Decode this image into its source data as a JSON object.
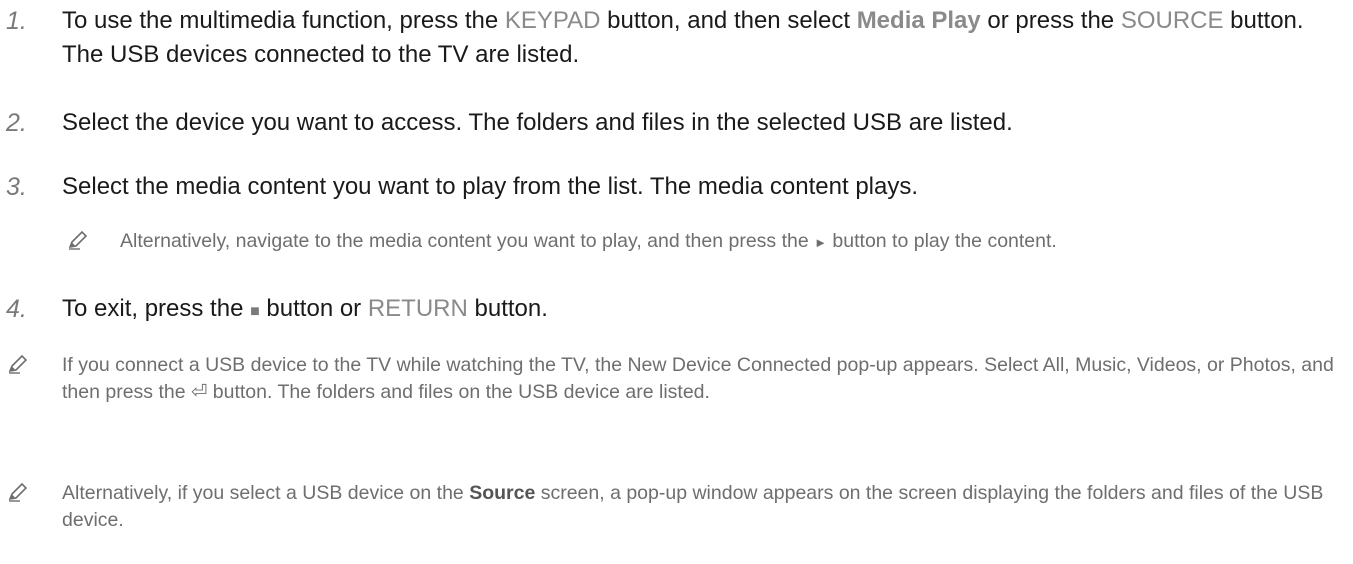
{
  "steps": [
    {
      "num": "1.",
      "parts": [
        {
          "t": "To use the multimedia function, press the "
        },
        {
          "t": "KEYPAD",
          "kw": true
        },
        {
          "t": " button, and then select "
        },
        {
          "t": "Media Play",
          "kwb": true
        },
        {
          "t": " or press the "
        },
        {
          "t": "SOURCE",
          "kw": true
        },
        {
          "t": " button. The USB devices connected to the TV are listed."
        }
      ]
    },
    {
      "num": "2.",
      "parts": [
        {
          "t": "Select the device you want to access. The folders and files in the selected USB are listed."
        }
      ]
    },
    {
      "num": "3.",
      "parts": [
        {
          "t": "Select the media content you want to play from the list. The media content plays."
        }
      ]
    },
    {
      "num": "4.",
      "parts": [
        {
          "t": "To exit, press the "
        },
        {
          "t": "■",
          "glyph": "stop-icon"
        },
        {
          "t": " button or "
        },
        {
          "t": "RETURN",
          "kw": true
        },
        {
          "t": " button."
        }
      ]
    }
  ],
  "sub_note": {
    "icon": "pencil-note-icon",
    "parts": [
      {
        "t": "Alternatively, navigate to the media content you want to play, and then press the "
      },
      {
        "t": "►",
        "glyph": "play-icon"
      },
      {
        "t": " button to play the content."
      }
    ]
  },
  "notes": [
    {
      "icon": "pencil-note-icon",
      "parts": [
        {
          "t": "If you connect a USB device to the TV while watching the TV, the New Device Connected pop-up appears. Select All, Music, Videos, or Photos, and then press the "
        },
        {
          "t": "⏎",
          "glyph": "enter-icon"
        },
        {
          "t": " button. The folders and files on the USB device are listed."
        }
      ]
    },
    {
      "icon": "pencil-note-icon",
      "parts": [
        {
          "t": "Alternatively, if you select a USB device on the "
        },
        {
          "t": "Source",
          "kwb": true
        },
        {
          "t": " screen, a pop-up window appears on the screen displaying the folders and files of the USB device."
        }
      ]
    }
  ]
}
